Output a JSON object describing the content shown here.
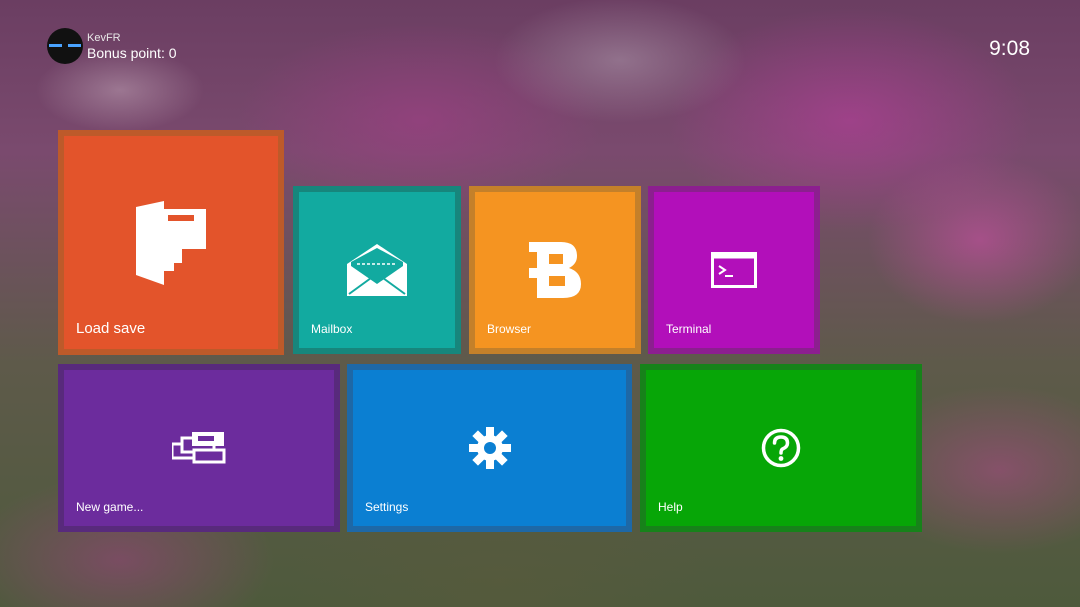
{
  "header": {
    "username": "KevFR",
    "bonus_text": "Bonus point: 0",
    "clock": "9:08"
  },
  "tiles": [
    {
      "label": "Load save",
      "icon": "folder-doc-icon",
      "color": "#e3542b"
    },
    {
      "label": "Mailbox",
      "icon": "envelope-icon",
      "color": "#12aaa0"
    },
    {
      "label": "Browser",
      "icon": "browser-b-icon",
      "color": "#f59421"
    },
    {
      "label": "Terminal",
      "icon": "terminal-icon",
      "color": "#b20fba"
    },
    {
      "label": "New game...",
      "icon": "windows-stack-icon",
      "color": "#6c2c9d"
    },
    {
      "label": "Settings",
      "icon": "gear-icon",
      "color": "#0b7fd2"
    },
    {
      "label": "Help",
      "icon": "help-icon",
      "color": "#07a607"
    }
  ]
}
